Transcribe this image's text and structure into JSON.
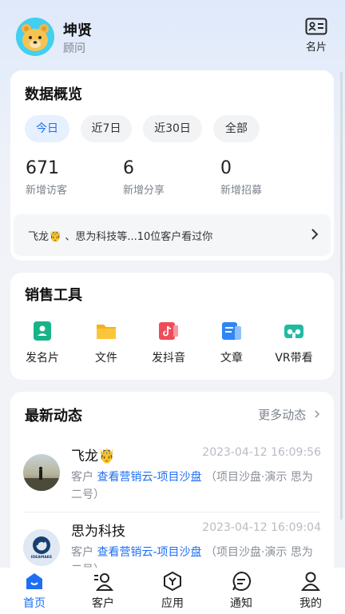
{
  "user": {
    "name": "坤贤",
    "role": "顾问",
    "avatar_icon": "bear-avatar"
  },
  "card_button": {
    "label": "名片",
    "icon": "id-card-icon"
  },
  "overview": {
    "title": "数据概览",
    "tabs": [
      {
        "label": "今日",
        "active": true
      },
      {
        "label": "近7日",
        "active": false
      },
      {
        "label": "近30日",
        "active": false
      },
      {
        "label": "全部",
        "active": false
      }
    ],
    "stats": [
      {
        "value": "671",
        "label": "新增访客"
      },
      {
        "value": "6",
        "label": "新增分享"
      },
      {
        "value": "0",
        "label": "新增招募"
      }
    ],
    "visitors_text": "飞龙🤴 、思为科技等...10位客户看过你"
  },
  "tools": {
    "title": "销售工具",
    "items": [
      {
        "label": "发名片",
        "icon": "business-card-icon",
        "color": "#19b38a"
      },
      {
        "label": "文件",
        "icon": "folder-icon",
        "color": "#f5b21b"
      },
      {
        "label": "发抖音",
        "icon": "douyin-icon",
        "color": "#ef4c59"
      },
      {
        "label": "文章",
        "icon": "article-icon",
        "color": "#2f86f6"
      },
      {
        "label": "VR带看",
        "icon": "vr-headset-icon",
        "color": "#22b9a4"
      }
    ]
  },
  "feed": {
    "title": "最新动态",
    "more_label": "更多动态",
    "items": [
      {
        "name": "飞龙🤴",
        "time": "2023-04-12 16:09:56",
        "prefix": "客户",
        "action": "查看营销云-项目沙盘",
        "suffix": "（项目沙盘·演示 思为二号）"
      },
      {
        "name": "思为科技",
        "time": "2023-04-12 16:09:04",
        "prefix": "客户",
        "action": "查看营销云-项目沙盘",
        "suffix": "（项目沙盘·演示 思为二号）",
        "avatar_text": "IDEAMAKE"
      }
    ]
  },
  "tabbar": {
    "items": [
      {
        "label": "首页",
        "icon": "home-icon",
        "active": true
      },
      {
        "label": "客户",
        "icon": "customers-icon",
        "active": false
      },
      {
        "label": "应用",
        "icon": "apps-icon",
        "active": false
      },
      {
        "label": "通知",
        "icon": "notification-icon",
        "active": false
      },
      {
        "label": "我的",
        "icon": "profile-icon",
        "active": false
      }
    ]
  },
  "colors": {
    "accent": "#1e6ff3",
    "link": "#1e6ff3"
  }
}
